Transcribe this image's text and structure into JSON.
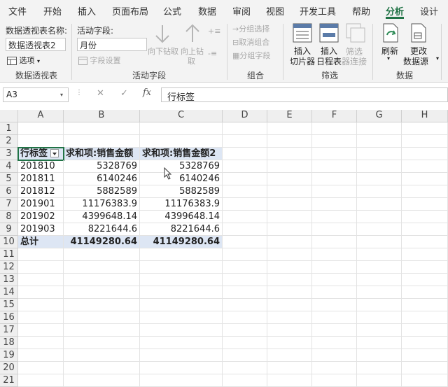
{
  "tabs": [
    "文件",
    "开始",
    "插入",
    "页面布局",
    "公式",
    "数据",
    "审阅",
    "视图",
    "开发工具",
    "帮助",
    "分析",
    "设计"
  ],
  "active_tab": "分析",
  "ribbon": {
    "pivot_name_label": "数据透视表名称:",
    "pivot_name_value": "数据透视表2",
    "options_label": "选项",
    "group_pivot": "数据透视表",
    "active_field_label": "活动字段:",
    "active_field_value": "月份",
    "field_settings": "字段设置",
    "drill_down": "向下钻取",
    "drill_up_1": "向上钻",
    "drill_up_2": "取",
    "group_active_field": "活动字段",
    "group_selection": "分组选择",
    "ungroup": "取消组合",
    "group_field": "分组字段",
    "group_group": "组合",
    "insert_slicer_1": "插入",
    "insert_slicer_2": "切片器",
    "insert_timeline_1": "插入",
    "insert_timeline_2": "日程表",
    "filter_conn_1": "筛选",
    "filter_conn_2": "器连接",
    "group_filter": "筛选",
    "refresh": "刷新",
    "change_source_1": "更改",
    "change_source_2": "数据源",
    "group_data": "数据"
  },
  "formula_bar": {
    "name_box": "A3",
    "formula": "行标签"
  },
  "columns": [
    "A",
    "B",
    "C",
    "D",
    "E",
    "F",
    "G",
    "H"
  ],
  "rows": [
    "1",
    "2",
    "3",
    "4",
    "5",
    "6",
    "7",
    "8",
    "9",
    "10",
    "11",
    "12",
    "13",
    "14",
    "15",
    "16",
    "17",
    "18",
    "19",
    "20",
    "21"
  ],
  "pivot": {
    "header": [
      "行标签",
      "求和项:销售金额",
      "求和项:销售金额2"
    ],
    "data": [
      [
        "201810",
        "5328769",
        "5328769"
      ],
      [
        "201811",
        "6140246",
        "6140246"
      ],
      [
        "201812",
        "5882589",
        "5882589"
      ],
      [
        "201901",
        "11176383.9",
        "11176383.9"
      ],
      [
        "201902",
        "4399648.14",
        "4399648.14"
      ],
      [
        "201903",
        "8221644.6",
        "8221644.6"
      ]
    ],
    "total": [
      "总计",
      "41149280.64",
      "41149280.64"
    ]
  },
  "colors": {
    "accent": "#217346",
    "pivot_header_bg": "#dde6f4"
  }
}
